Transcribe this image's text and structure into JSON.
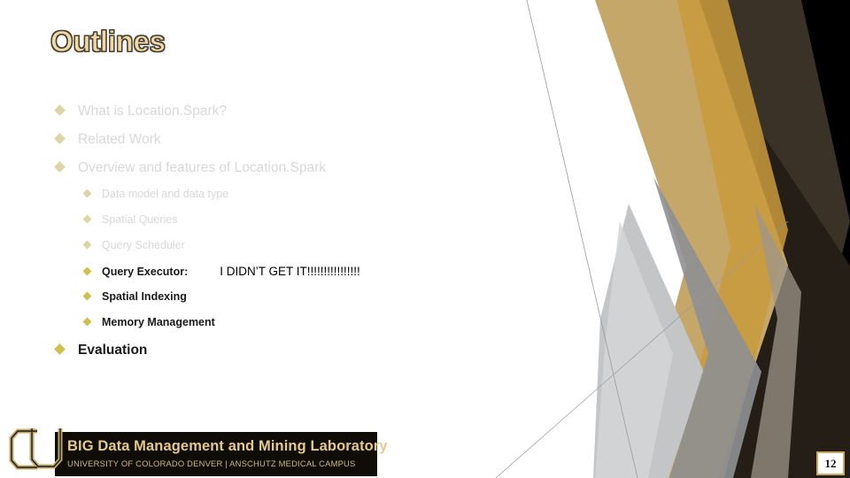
{
  "slide": {
    "title": "Outlines",
    "page_number": "12",
    "title_color": "#efd9a4",
    "accent_gold": "#c6a76a",
    "faded_text_color": "#d8d8d8",
    "active_text_color": "#1a1a1a"
  },
  "outline": [
    {
      "level": 1,
      "text": "What is Location.Spark?",
      "state": "faded",
      "bullet": "diamond-bullet"
    },
    {
      "level": 1,
      "text": "Related Work",
      "state": "faded",
      "bullet": "diamond-bullet"
    },
    {
      "level": 1,
      "text": "Overview and features of Location.Spark",
      "state": "faded",
      "bullet": "diamond-bullet"
    },
    {
      "level": 2,
      "text": "Data model and data type",
      "state": "faded",
      "bullet": "diamond-bullet"
    },
    {
      "level": 2,
      "text": "Spatial Queries",
      "state": "faded",
      "bullet": "diamond-bullet"
    },
    {
      "level": 2,
      "text": "Query Scheduler",
      "state": "faded",
      "bullet": "diamond-bullet"
    },
    {
      "level": 2,
      "text": "Query Executor:",
      "state": "active",
      "bullet": "diamond-bullet",
      "annotation_text": "I DIDN’T GET IT",
      "annotation_bangs": "!!!!!!!!!!!!!!!!"
    },
    {
      "level": 2,
      "text": "Spatial Indexing",
      "state": "active",
      "bullet": "diamond-bullet"
    },
    {
      "level": 2,
      "text": "Memory Management",
      "state": "active",
      "bullet": "diamond-bullet"
    },
    {
      "level": 1,
      "text": "Evaluation",
      "state": "active",
      "bullet": "diamond-bullet"
    }
  ],
  "footer": {
    "logo_text": "CU",
    "line1": "BIG Data Management and Mining Laboratory",
    "line2": "UNIVERSITY OF COLORADO DENVER | ANSCHUTZ MEDICAL CAMPUS"
  }
}
